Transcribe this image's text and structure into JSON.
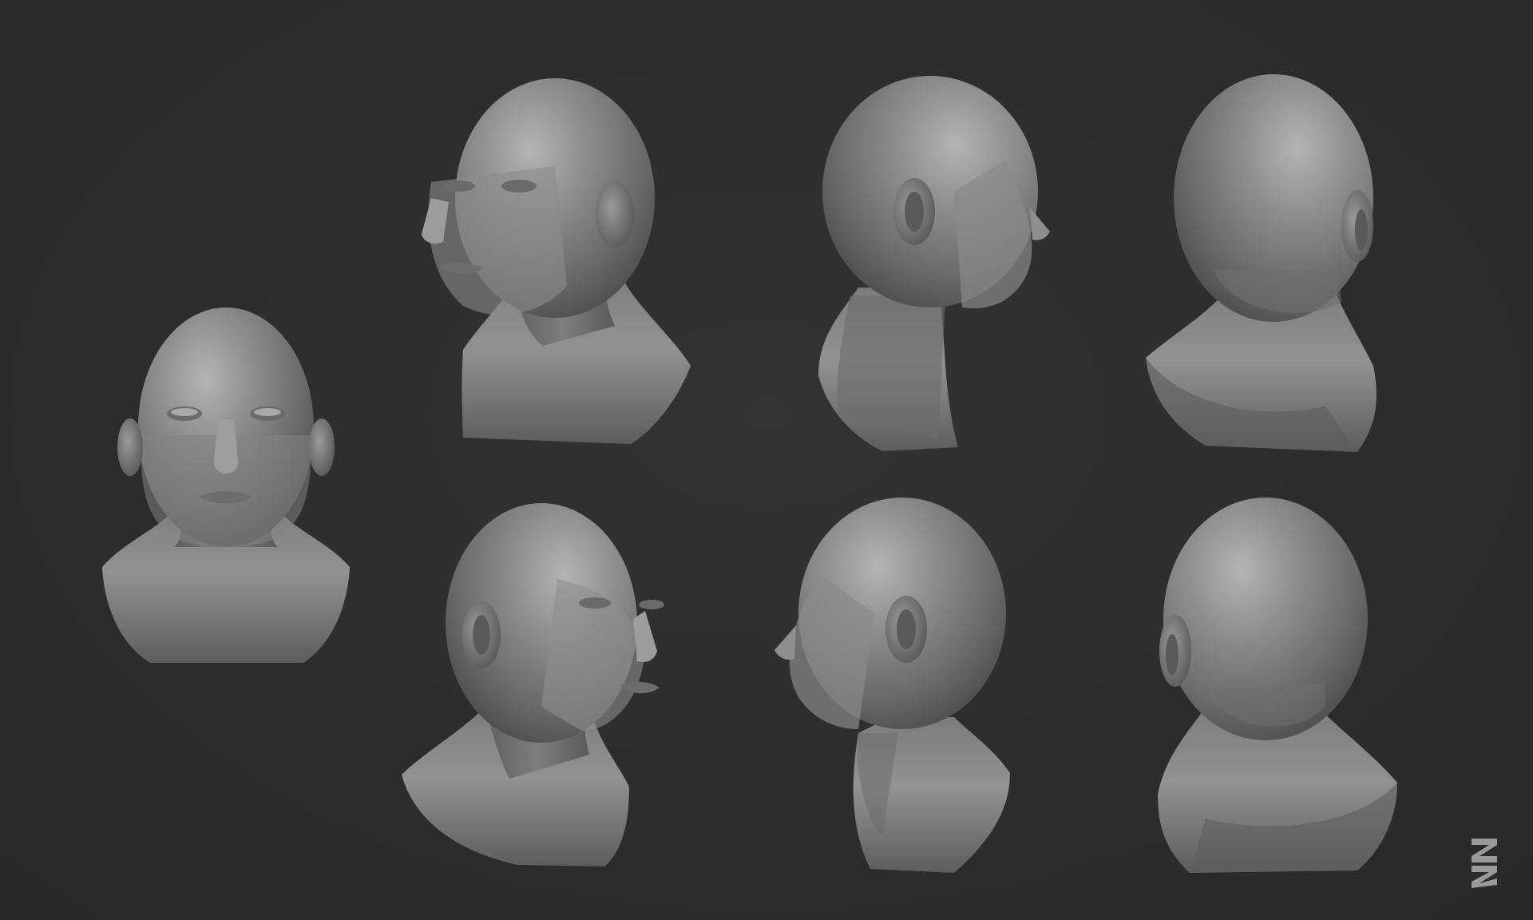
{
  "scene": {
    "background_color": "#2d2d2f",
    "clay_color": "#8a8a8a",
    "views": [
      {
        "id": "front",
        "label": ""
      },
      {
        "id": "three-quarter-left-up",
        "label": ""
      },
      {
        "id": "profile-right-back",
        "label": ""
      },
      {
        "id": "back-three-quarter-right",
        "label": ""
      },
      {
        "id": "three-quarter-right-down",
        "label": ""
      },
      {
        "id": "profile-left",
        "label": ""
      },
      {
        "id": "back-three-quarter-left",
        "label": ""
      }
    ]
  },
  "logo": {
    "icon": "brand-mark-icon",
    "color": "#9a9a9a"
  }
}
